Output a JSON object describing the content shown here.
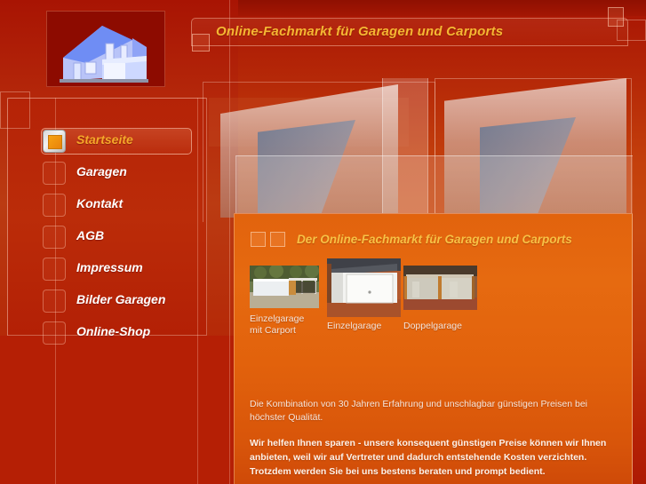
{
  "site": {
    "header_title": "Online-Fachmarkt für Garagen und Carports",
    "logo_alt": "house-logo"
  },
  "nav": {
    "items": [
      {
        "label": "Startseite",
        "active": true
      },
      {
        "label": "Garagen",
        "active": false
      },
      {
        "label": "Kontakt",
        "active": false
      },
      {
        "label": "AGB",
        "active": false
      },
      {
        "label": "Impressum",
        "active": false
      },
      {
        "label": "Bilder Garagen",
        "active": false
      },
      {
        "label": "Online-Shop",
        "active": false
      }
    ]
  },
  "content": {
    "title": "Der Online-Fachmarkt für Garagen und Carports",
    "thumbs": [
      {
        "caption": "Einzelgarage\nmit Carport",
        "alt": "einzelgarage-mit-carport-photo"
      },
      {
        "caption": "Einzelgarage",
        "alt": "einzelgarage-photo"
      },
      {
        "caption": "Doppelgarage",
        "alt": "doppelgarage-photo"
      }
    ],
    "paragraph1": "Die Kombination von 30 Jahren Erfahrung und unschlagbar günstigen Preisen bei höchster Qualität.",
    "paragraph2": "Wir helfen Ihnen sparen - unsere konsequent günstigen Preise können wir Ihnen anbieten, weil wir auf Vertreter und dadurch entstehende Kosten verzichten. Trotzdem werden Sie bei uns bestens beraten und prompt bedient."
  },
  "colors": {
    "background_dark_red": "#a81403",
    "background_orange": "#c8490e",
    "panel_orange": "#e2630d",
    "accent_gold": "#f5b733",
    "nav_text": "#ffffff",
    "active_nav_text": "#f5a82a",
    "logo_background": "#8d0b00",
    "logo_house_blue": "#5b7bf0"
  }
}
